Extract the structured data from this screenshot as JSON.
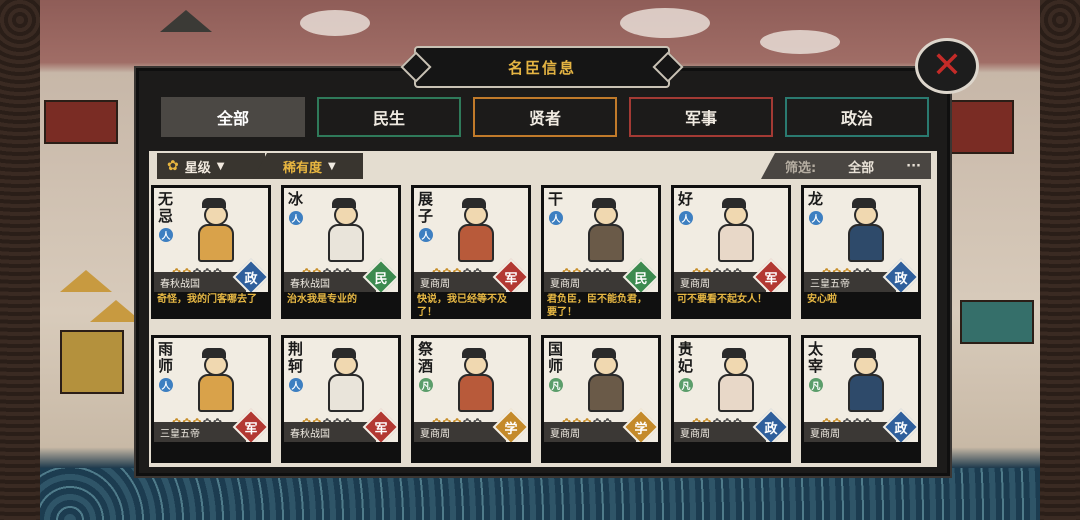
{
  "dialog": {
    "title": "名臣信息",
    "tabs": [
      {
        "label": "全部",
        "active": true
      },
      {
        "label": "民生"
      },
      {
        "label": "贤者"
      },
      {
        "label": "军事"
      },
      {
        "label": "政治"
      }
    ],
    "filters": {
      "star_label": "星级",
      "rarity_label": "稀有度",
      "filter_label": "筛选:",
      "filter_value": "全部",
      "more_icon": "···"
    }
  },
  "cards_row1": [
    {
      "name": "无忌",
      "clan": "人",
      "stars": 2,
      "era": "春秋战国",
      "type": "政",
      "quote": "奇怪，我的门客哪去了"
    },
    {
      "name": "冰",
      "clan": "人",
      "stars": 2,
      "era": "春秋战国",
      "type": "民",
      "quote": "治水我是专业的"
    },
    {
      "name": "展子",
      "clan": "人",
      "stars": 3,
      "era": "夏商周",
      "type": "军",
      "quote": "快说，我已经等不及了！"
    },
    {
      "name": "干",
      "clan": "人",
      "stars": 2,
      "era": "夏商周",
      "type": "民",
      "quote": "君负臣，臣不能负君，要了！"
    },
    {
      "name": "好",
      "clan": "人",
      "stars": 2,
      "era": "夏商周",
      "type": "军",
      "quote": "可不要看不起女人！"
    },
    {
      "name": "龙",
      "clan": "人",
      "stars": 3,
      "era": "三皇五帝",
      "type": "政",
      "quote": "安心啦"
    }
  ],
  "cards_row2": [
    {
      "name": "雨师",
      "clan": "人",
      "stars": 3,
      "era": "三皇五帝",
      "type": "军"
    },
    {
      "name": "荆轲",
      "clan": "人",
      "stars": 2,
      "era": "春秋战国",
      "type": "军"
    },
    {
      "name": "祭酒",
      "clan": "凡",
      "stars": 3,
      "era": "夏商周",
      "type": "学"
    },
    {
      "name": "国师",
      "clan": "凡",
      "stars": 3,
      "era": "夏商周",
      "type": "学"
    },
    {
      "name": "贵妃",
      "clan": "凡",
      "stars": 2,
      "era": "夏商周",
      "type": "政"
    },
    {
      "name": "太宰",
      "clan": "凡",
      "stars": 2,
      "era": "夏商周",
      "type": "政"
    }
  ],
  "colors": {
    "gold": "#e4b443",
    "minsheng": "#3c8a4f",
    "junshi": "#b23832",
    "zhengzhi": "#2f5f9c",
    "xue": "#c48a2a"
  }
}
